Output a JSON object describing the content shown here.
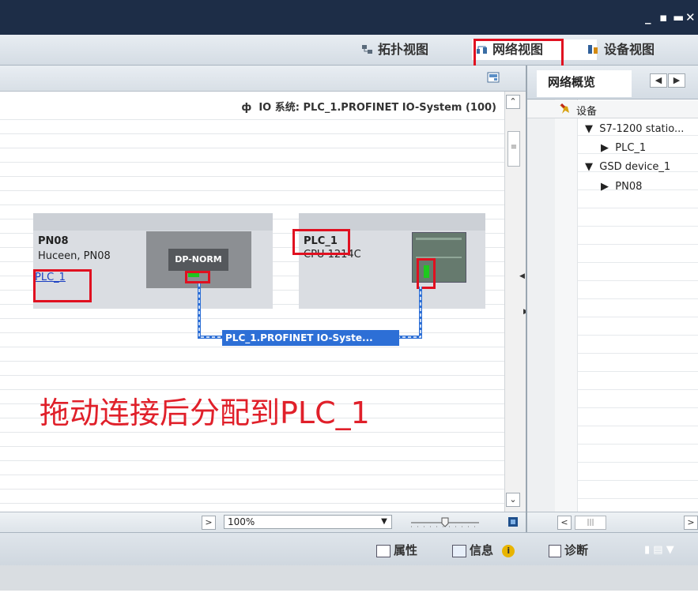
{
  "window": {
    "controls": [
      "_",
      "▪",
      "▬",
      "✕"
    ]
  },
  "view_tabs": {
    "topology": "拓扑视图",
    "network": "网络视图",
    "device": "设备视图"
  },
  "canvas": {
    "io_system_label": "IO 系统: PLC_1.PROFINET IO-System (100)",
    "devices": {
      "pn08": {
        "name": "PN08",
        "subtitle": "Huceen, PN08",
        "assigned_link": "PLC_1",
        "module_label": "DP-NORM"
      },
      "plc": {
        "name": "PLC_1",
        "cpu": "CPU 1214C"
      }
    },
    "network_label": "PLC_1.PROFINET IO-Syste...",
    "annotation": "拖动连接后分配到PLC_1"
  },
  "zoom": {
    "value": "100%",
    "level_fraction": 0.5
  },
  "overview": {
    "tab_label": "网络概览",
    "header_label": "设备",
    "tree": [
      {
        "label": "S7-1200 statio...",
        "level": 1,
        "expanded": true
      },
      {
        "label": "PLC_1",
        "level": 2,
        "expanded": false
      },
      {
        "label": "GSD device_1",
        "level": 1,
        "expanded": true
      },
      {
        "label": "PN08",
        "level": 2,
        "expanded": false
      }
    ]
  },
  "inspector_tabs": {
    "properties": "属性",
    "info": "信息",
    "diagnostics": "诊断"
  },
  "colors": {
    "title_bar": "#1d2d47",
    "highlight_box": "#e01020",
    "network_line": "#2d6fd6",
    "annotation": "#e0202a"
  }
}
